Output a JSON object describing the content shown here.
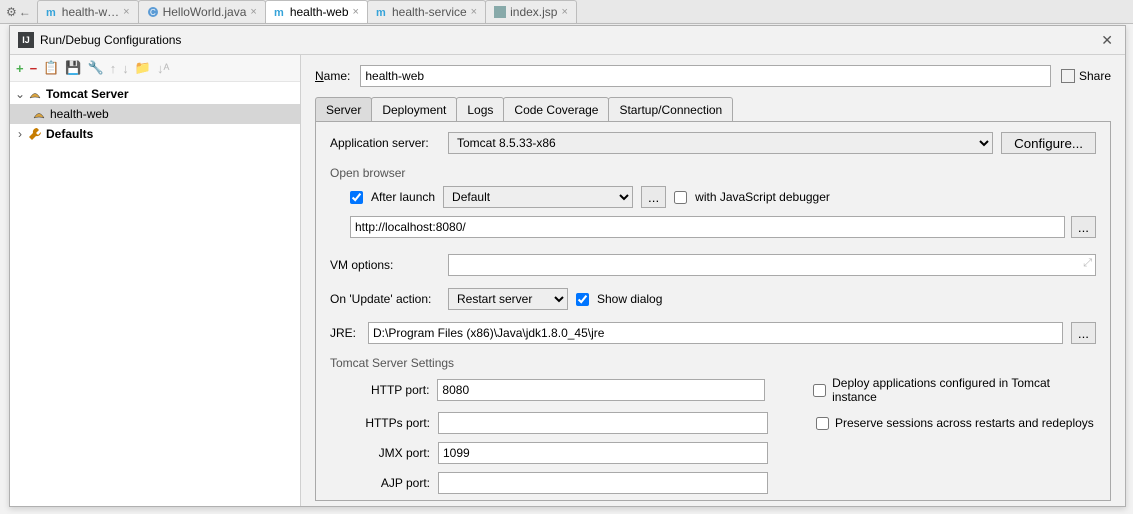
{
  "editorTabs": {
    "t0": "health-w…",
    "t1": "HelloWorld.java",
    "t2": "health-web",
    "t3": "health-service",
    "t4": "index.jsp"
  },
  "dialog": {
    "title": "Run/Debug Configurations"
  },
  "tree": {
    "tomcatServer": "Tomcat Server",
    "healthWeb": "health-web",
    "defaults": "Defaults"
  },
  "form": {
    "nameLabel": "Name:",
    "nameValue": "health-web",
    "shareLabel": "Share"
  },
  "tabs": {
    "server": "Server",
    "deployment": "Deployment",
    "logs": "Logs",
    "codeCoverage": "Code Coverage",
    "startup": "Startup/Connection"
  },
  "server": {
    "appServerLabel": "Application server:",
    "appServerValue": "Tomcat 8.5.33-x86",
    "configureBtn": "Configure...",
    "openBrowser": "Open browser",
    "afterLaunch": "After launch",
    "browserDefault": "Default",
    "ellipsis": "...",
    "withJsDebugger": "with JavaScript debugger",
    "url": "http://localhost:8080/",
    "vmOptionsLabel": "VM options:",
    "vmOptionsValue": "",
    "onUpdateLabel": "On 'Update' action:",
    "restartServer": "Restart server",
    "showDialog": "Show dialog",
    "jreLabel": "JRE:",
    "jreValue": "D:\\Program Files (x86)\\Java\\jdk1.8.0_45\\jre",
    "tomcatSettings": "Tomcat Server Settings",
    "httpPortLabel": "HTTP port:",
    "httpPortValue": "8080",
    "httpsPortLabel": "HTTPs port:",
    "httpsPortValue": "",
    "jmxPortLabel": "JMX port:",
    "jmxPortValue": "1099",
    "ajpPortLabel": "AJP port:",
    "ajpPortValue": "",
    "deployApps": "Deploy applications configured in Tomcat instance",
    "preserveSessions": "Preserve sessions across restarts and redeploys"
  }
}
